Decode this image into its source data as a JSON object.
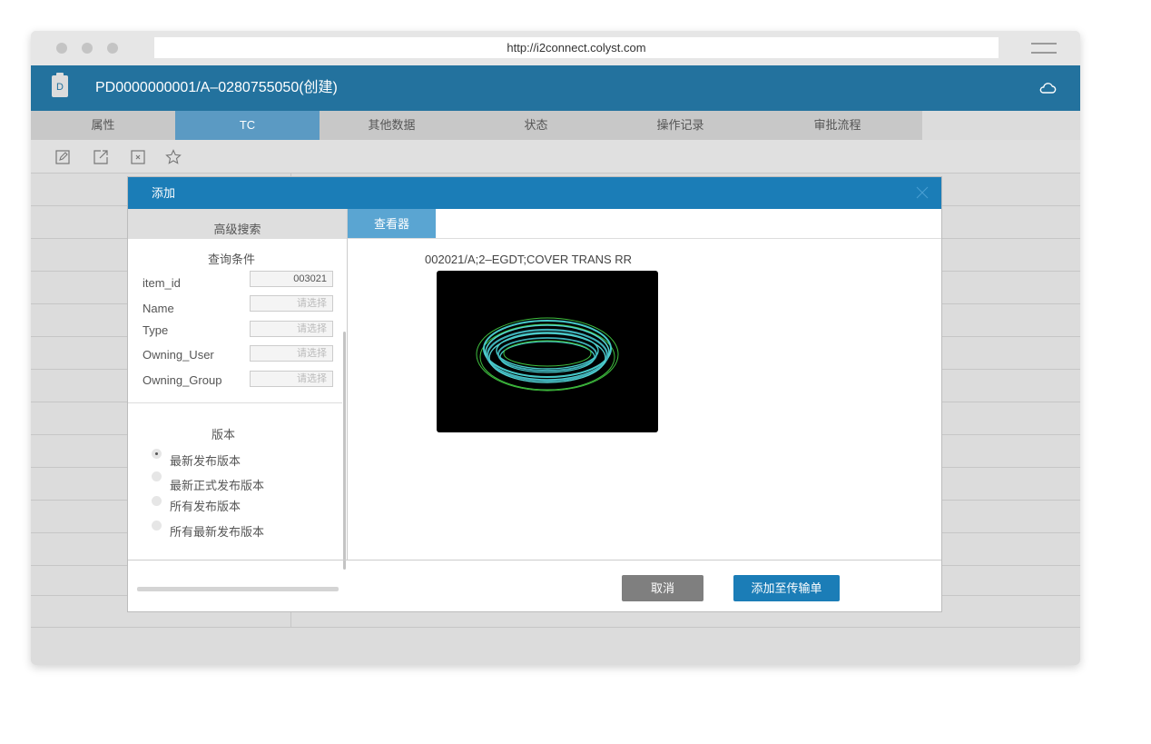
{
  "browser": {
    "url": "http://i2connect.colyst.com"
  },
  "header": {
    "doc_letter": "D",
    "title": "PD0000000001/A–0280755050(创建)"
  },
  "tabs": [
    "属性",
    "TC",
    "其他数据",
    "状态",
    "操作记录",
    "审批流程"
  ],
  "active_tab": "TC",
  "dialog": {
    "title": "添加",
    "left_tab": "高级搜索",
    "query_title": "查询条件",
    "fields": [
      {
        "label": "item_id",
        "value": "003021"
      },
      {
        "label": "Name",
        "placeholder": "请选择"
      },
      {
        "label": "Type",
        "placeholder": "请选择"
      },
      {
        "label": "Owning_User",
        "placeholder": "请选择"
      },
      {
        "label": "Owning_Group",
        "placeholder": "请选择"
      }
    ],
    "version_title": "版本",
    "versions": [
      {
        "label": "最新发布版本",
        "selected": true
      },
      {
        "label": "最新正式发布版本",
        "selected": false
      },
      {
        "label": "所有发布版本",
        "selected": false
      },
      {
        "label": "所有最新发布版本",
        "selected": false
      }
    ],
    "viewer_tab": "查看器",
    "viewer_caption": "002021/A;2–EGDT;COVER TRANS RR",
    "cancel_label": "取消",
    "add_label": "添加至传输单"
  },
  "colors": {
    "primary": "#1b7db7",
    "title_bar": "#23729e",
    "active_tab": "#5b9ac3",
    "cancel": "#7f7f7f"
  }
}
